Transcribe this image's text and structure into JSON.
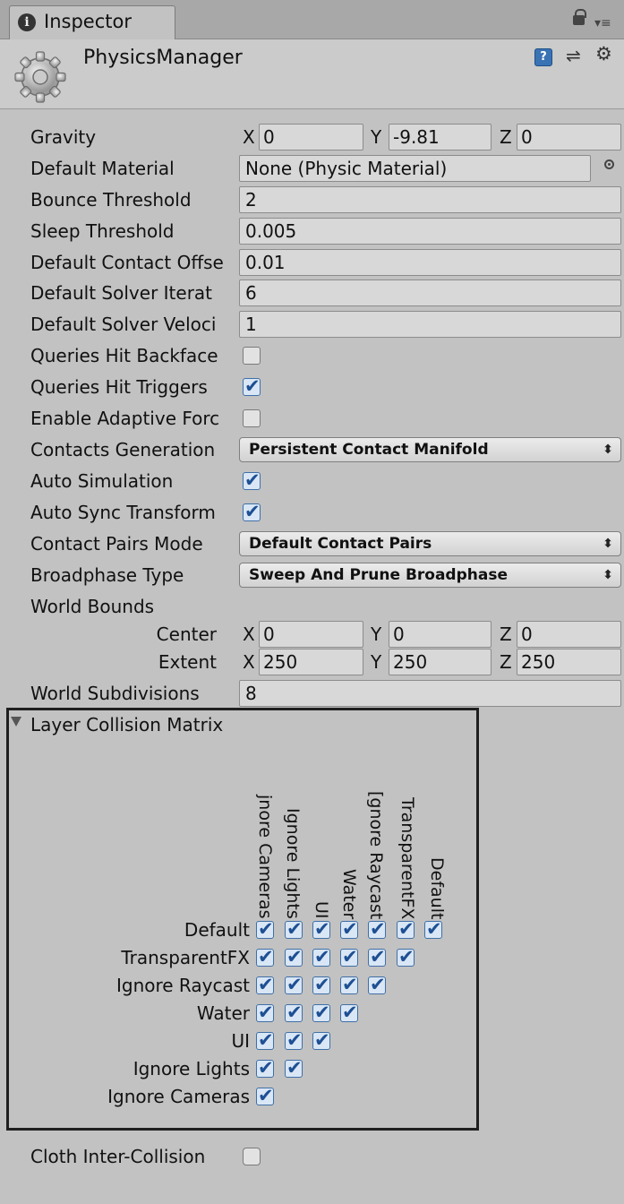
{
  "tab": {
    "label": "Inspector"
  },
  "object": {
    "name": "PhysicsManager"
  },
  "gravity": {
    "label": "Gravity",
    "x_label": "X",
    "x": "0",
    "y_label": "Y",
    "y": "-9.81",
    "z_label": "Z",
    "z": "0"
  },
  "default_material": {
    "label": "Default Material",
    "value": "None (Physic Material)"
  },
  "bounce_threshold": {
    "label": "Bounce Threshold",
    "value": "2"
  },
  "sleep_threshold": {
    "label": "Sleep Threshold",
    "value": "0.005"
  },
  "default_contact_offset": {
    "label": "Default Contact Offse",
    "value": "0.01"
  },
  "default_solver_iterations": {
    "label": "Default Solver Iterat",
    "value": "6"
  },
  "default_solver_velocity": {
    "label": "Default Solver Veloci",
    "value": "1"
  },
  "queries_hit_backfaces": {
    "label": "Queries Hit Backface",
    "checked": false
  },
  "queries_hit_triggers": {
    "label": "Queries Hit Triggers",
    "checked": true
  },
  "enable_adaptive_force": {
    "label": "Enable Adaptive Forc",
    "checked": false
  },
  "contacts_generation": {
    "label": "Contacts Generation",
    "value": "Persistent Contact Manifold"
  },
  "auto_simulation": {
    "label": "Auto Simulation",
    "checked": true
  },
  "auto_sync_transforms": {
    "label": "Auto Sync Transform",
    "checked": true
  },
  "contact_pairs_mode": {
    "label": "Contact Pairs Mode",
    "value": "Default Contact Pairs"
  },
  "broadphase_type": {
    "label": "Broadphase Type",
    "value": "Sweep And Prune Broadphase"
  },
  "world_bounds": {
    "label": "World Bounds",
    "center": {
      "label": "Center",
      "x_label": "X",
      "x": "0",
      "y_label": "Y",
      "y": "0",
      "z_label": "Z",
      "z": "0"
    },
    "extent": {
      "label": "Extent",
      "x_label": "X",
      "x": "250",
      "y_label": "Y",
      "y": "250",
      "z_label": "Z",
      "z": "250"
    }
  },
  "world_subdivisions": {
    "label": "World Subdivisions",
    "value": "8"
  },
  "layer_matrix": {
    "title": "Layer Collision Matrix",
    "columns": [
      "Default",
      "TransparentFX",
      "Ignore Raycast",
      "Water",
      "UI",
      "Ignore Lights",
      "Ignore Cameras"
    ],
    "column_display": [
      "Default",
      "TransparentFX",
      "[gnore Raycast",
      "Water",
      "UI",
      "Ignore Lights",
      "jnore Cameras"
    ],
    "rows": [
      "Default",
      "TransparentFX",
      "Ignore Raycast",
      "Water",
      "UI",
      "Ignore Lights",
      "Ignore Cameras"
    ],
    "all_checked": true
  },
  "cloth_inter_collision": {
    "label": "Cloth Inter-Collision",
    "checked": false
  },
  "colors": {
    "panel_bg": "#c2c2c2",
    "check_blue": "#1d4f93",
    "help_blue": "#3a73b4"
  }
}
